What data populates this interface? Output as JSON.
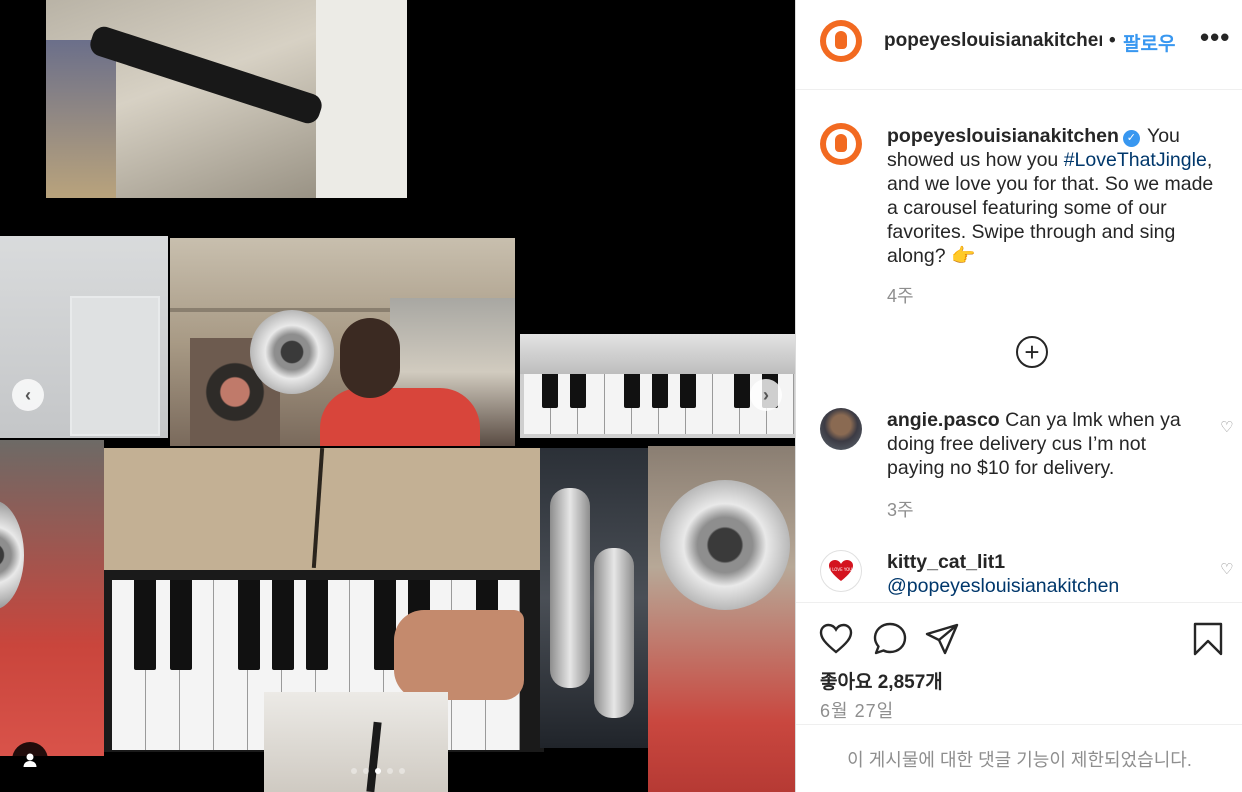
{
  "media": {
    "active_slide_index": 2,
    "slide_count": 5,
    "prev_glyph": "‹",
    "next_glyph": "›"
  },
  "header": {
    "username": "popeyeslouisianakitchen",
    "separator": "•",
    "follow_label": "팔로우",
    "more_label": "•••"
  },
  "caption": {
    "username": "popeyeslouisianakitchen",
    "verified_glyph": "✓",
    "text_before": " You showed us how you ",
    "hashtag": "#LoveThatJingle",
    "text_after": ", and we love you for that. So we made a carousel featuring some of our favorites. Swipe through and sing along? 👉",
    "time": "4주"
  },
  "load_more_glyph": "+",
  "comments": [
    {
      "username": "angie.pasco",
      "text": " Can ya lmk when ya doing free delivery cus I’m not paying no $10 for delivery.",
      "time": "3주",
      "like_glyph": "♡"
    },
    {
      "username": "kitty_cat_lit1",
      "mention": "@popeyeslouisianakitchen",
      "like_glyph": "♡",
      "avatar_heart_text": "I LOVE YOU"
    }
  ],
  "actions": {
    "icons": [
      "heart-icon",
      "comment-icon",
      "share-icon",
      "bookmark-icon"
    ],
    "likes": "좋아요 2,857개",
    "date": "6월 27일"
  },
  "comments_disabled_text": "이 게시물에 대한 댓글 기능이 제한되었습니다.",
  "colors": {
    "brand_orange": "#f26a21",
    "link_blue": "#3897f0",
    "hashtag_blue": "#00376b",
    "muted": "#8e8e8e"
  }
}
